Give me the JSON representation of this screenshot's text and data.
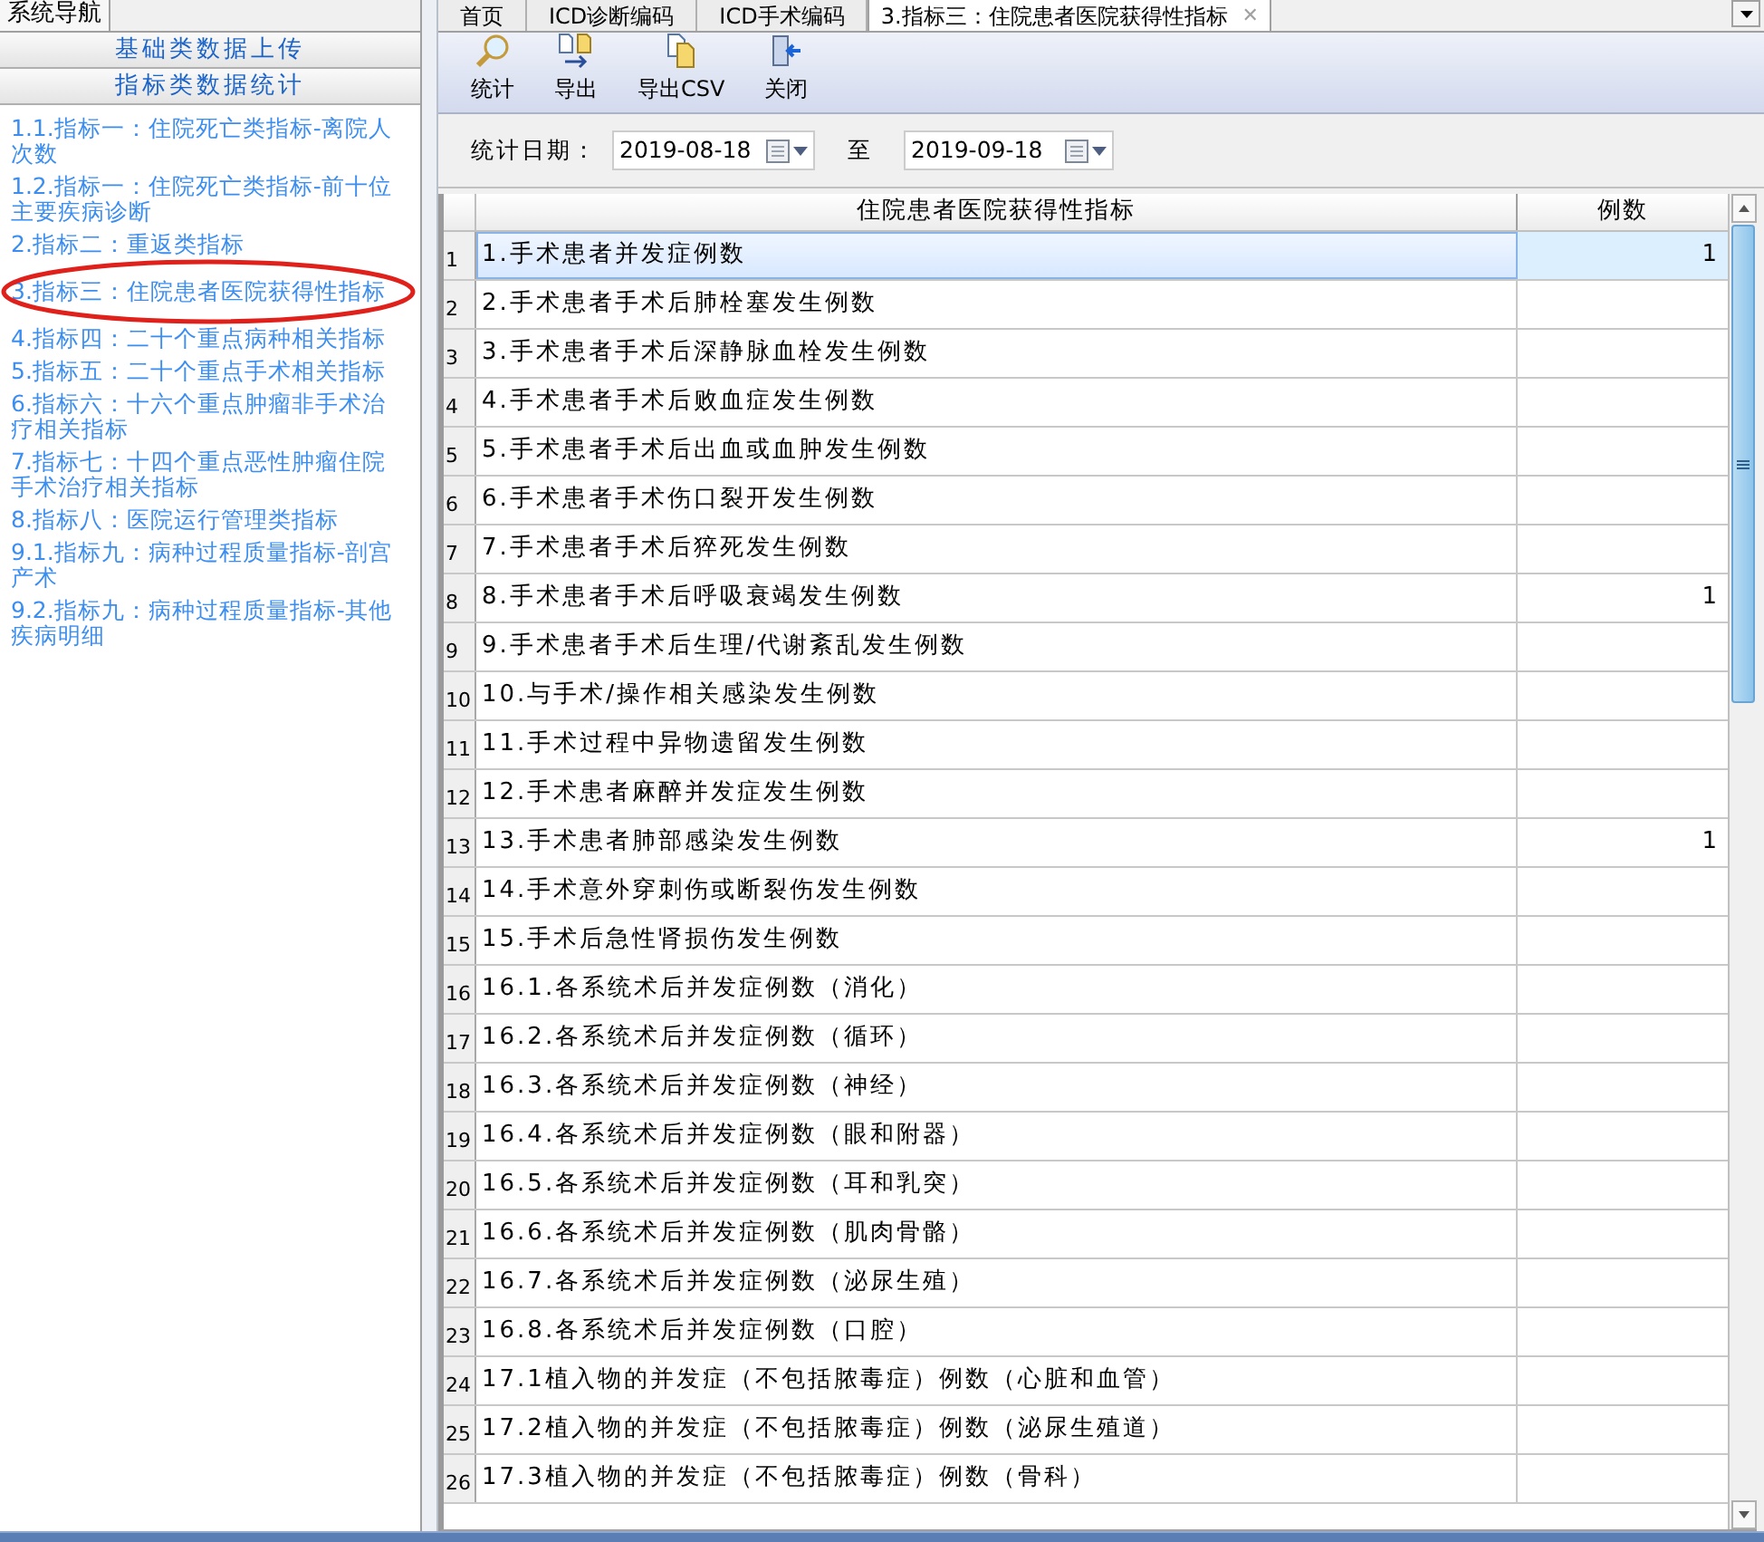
{
  "nav": {
    "title": "系统导航",
    "sections": [
      "基础类数据上传",
      "指标类数据统计"
    ],
    "items": [
      {
        "label": "1.1.指标一：住院死亡类指标-离院人次数",
        "circled": false
      },
      {
        "label": "1.2.指标一：住院死亡类指标-前十位主要疾病诊断",
        "circled": false
      },
      {
        "label": "2.指标二：重返类指标",
        "circled": false
      },
      {
        "label": "3.指标三：住院患者医院获得性指标",
        "circled": true
      },
      {
        "label": "4.指标四：二十个重点病种相关指标",
        "circled": false
      },
      {
        "label": "5.指标五：二十个重点手术相关指标",
        "circled": false
      },
      {
        "label": "6.指标六：十六个重点肿瘤非手术治疗相关指标",
        "circled": false
      },
      {
        "label": "7.指标七：十四个重点恶性肿瘤住院手术治疗相关指标",
        "circled": false
      },
      {
        "label": "8.指标八：医院运行管理类指标",
        "circled": false
      },
      {
        "label": "9.1.指标九：病种过程质量指标-剖宫产术",
        "circled": false
      },
      {
        "label": "9.2.指标九：病种过程质量指标-其他疾病明细",
        "circled": false
      }
    ]
  },
  "tabs": [
    {
      "label": "首页",
      "selected": false
    },
    {
      "label": "ICD诊断编码",
      "selected": false
    },
    {
      "label": "ICD手术编码",
      "selected": false
    },
    {
      "label": "3.指标三：住院患者医院获得性指标",
      "selected": true,
      "close": "✕"
    }
  ],
  "toolbar": [
    {
      "label": "统计",
      "kind": "search"
    },
    {
      "label": "导出",
      "kind": "export"
    },
    {
      "label": "导出CSV",
      "kind": "file"
    },
    {
      "label": "关闭",
      "kind": "exit"
    }
  ],
  "filter": {
    "label": "统计日期：",
    "from": "2019-08-18",
    "separator": "至",
    "to": "2019-09-18"
  },
  "table": {
    "columns": [
      "住院患者医院获得性指标",
      "例数"
    ],
    "rows": [
      {
        "number": "1",
        "name": "1.手术患者并发症例数",
        "count": "1",
        "selected": true
      },
      {
        "number": "2",
        "name": "2.手术患者手术后肺栓塞发生例数",
        "count": "",
        "selected": false
      },
      {
        "number": "3",
        "name": "3.手术患者手术后深静脉血栓发生例数",
        "count": "",
        "selected": false
      },
      {
        "number": "4",
        "name": "4.手术患者手术后败血症发生例数",
        "count": "",
        "selected": false
      },
      {
        "number": "5",
        "name": "5.手术患者手术后出血或血肿发生例数",
        "count": "",
        "selected": false
      },
      {
        "number": "6",
        "name": "6.手术患者手术伤口裂开发生例数",
        "count": "",
        "selected": false
      },
      {
        "number": "7",
        "name": "7.手术患者手术后猝死发生例数",
        "count": "",
        "selected": false
      },
      {
        "number": "8",
        "name": "8.手术患者手术后呼吸衰竭发生例数",
        "count": "1",
        "selected": false
      },
      {
        "number": "9",
        "name": "9.手术患者手术后生理/代谢紊乱发生例数",
        "count": "",
        "selected": false
      },
      {
        "number": "10",
        "name": "10.与手术/操作相关感染发生例数",
        "count": "",
        "selected": false
      },
      {
        "number": "11",
        "name": "11.手术过程中异物遗留发生例数",
        "count": "",
        "selected": false
      },
      {
        "number": "12",
        "name": "12.手术患者麻醉并发症发生例数",
        "count": "",
        "selected": false
      },
      {
        "number": "13",
        "name": "13.手术患者肺部感染发生例数",
        "count": "1",
        "selected": false
      },
      {
        "number": "14",
        "name": "14.手术意外穿刺伤或断裂伤发生例数",
        "count": "",
        "selected": false
      },
      {
        "number": "15",
        "name": "15.手术后急性肾损伤发生例数",
        "count": "",
        "selected": false
      },
      {
        "number": "16",
        "name": "16.1.各系统术后并发症例数（消化）",
        "count": "",
        "selected": false
      },
      {
        "number": "17",
        "name": "16.2.各系统术后并发症例数（循环）",
        "count": "",
        "selected": false
      },
      {
        "number": "18",
        "name": "16.3.各系统术后并发症例数（神经）",
        "count": "",
        "selected": false
      },
      {
        "number": "19",
        "name": "16.4.各系统术后并发症例数（眼和附器）",
        "count": "",
        "selected": false
      },
      {
        "number": "20",
        "name": "16.5.各系统术后并发症例数（耳和乳突）",
        "count": "",
        "selected": false
      },
      {
        "number": "21",
        "name": "16.6.各系统术后并发症例数（肌肉骨骼）",
        "count": "",
        "selected": false
      },
      {
        "number": "22",
        "name": "16.7.各系统术后并发症例数（泌尿生殖）",
        "count": "",
        "selected": false
      },
      {
        "number": "23",
        "name": "16.8.各系统术后并发症例数（口腔）",
        "count": "",
        "selected": false
      },
      {
        "number": "24",
        "name": "17.1植入物的并发症（不包括脓毒症）例数（心脏和血管）",
        "count": "",
        "selected": false
      },
      {
        "number": "25",
        "name": "17.2植入物的并发症（不包括脓毒症）例数（泌尿生殖道）",
        "count": "",
        "selected": false
      },
      {
        "number": "26",
        "name": "17.3植入物的并发症（不包括脓毒症）例数（骨科）",
        "count": "",
        "selected": false
      }
    ]
  }
}
